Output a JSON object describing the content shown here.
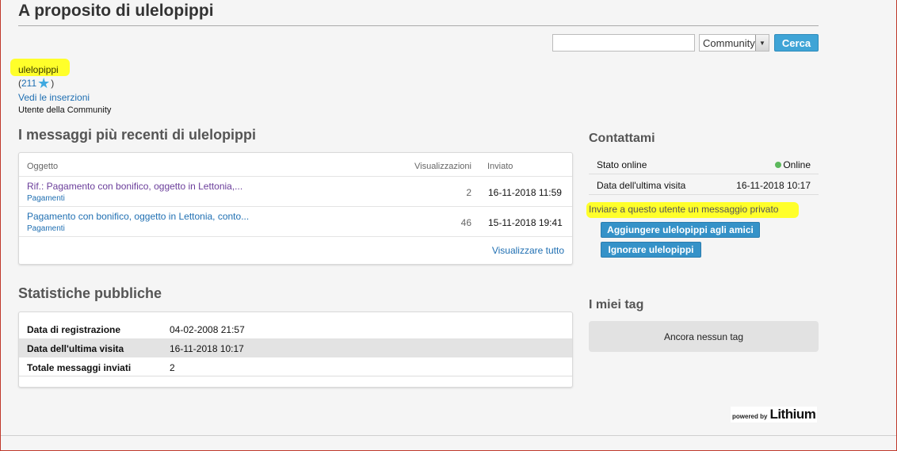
{
  "page": {
    "title": "A proposito di ulelopippi"
  },
  "search": {
    "placeholder": "",
    "scope": "Community",
    "button_label": "Cerca"
  },
  "profile": {
    "username": "ulelopippi",
    "kudos_open": "(",
    "kudos_count": "211",
    "kudos_close": ")",
    "view_posts": "Vedi le inserzioni",
    "rank": "Utente della Community"
  },
  "recent_messages": {
    "heading": "I messaggi più recenti di ulelopippi",
    "columns": {
      "subject": "Oggetto",
      "views": "Visualizzazioni",
      "posted": "Inviato"
    },
    "rows": [
      {
        "subject": "Rif.: Pagamento con bonifico, oggetto in Lettonia,...",
        "board": "Pagamenti",
        "views": "2",
        "date": "16-11-2018 11:59"
      },
      {
        "subject": "Pagamento con bonifico, oggetto in Lettonia, conto...",
        "board": "Pagamenti",
        "views": "46",
        "date": "15-11-2018 19:41"
      }
    ],
    "view_all": "Visualizzare tutto"
  },
  "stats": {
    "heading": "Statistiche pubbliche",
    "rows": [
      {
        "label": "Data di registrazione",
        "value": "04-02-2008 21:57"
      },
      {
        "label": "Data dell'ultima visita",
        "value": "16-11-2018 10:17"
      },
      {
        "label": "Totale messaggi inviati",
        "value": "2"
      }
    ]
  },
  "contact": {
    "heading": "Contattami",
    "online_label": "Stato online",
    "online_value": "Online",
    "last_visit_label": "Data dell'ultima visita",
    "last_visit_value": "16-11-2018 10:17",
    "private_message": "Inviare a questo utente un messaggio privato",
    "add_friend": "Aggiungere ulelopippi agli amici",
    "ignore": "Ignorare ulelopippi"
  },
  "tags": {
    "heading": "I miei tag",
    "empty": "Ancora nessun tag"
  },
  "footer": {
    "powered_by": "powered by",
    "brand": "Lithium"
  },
  "colors": {
    "accent": "#3fa4d6",
    "link": "#1f6fb2",
    "highlight": "#ffff2a",
    "online": "#5cb85c"
  },
  "icons": {
    "kudos": "star-icon",
    "select": "chevron-down-icon",
    "status": "online-dot-icon"
  }
}
